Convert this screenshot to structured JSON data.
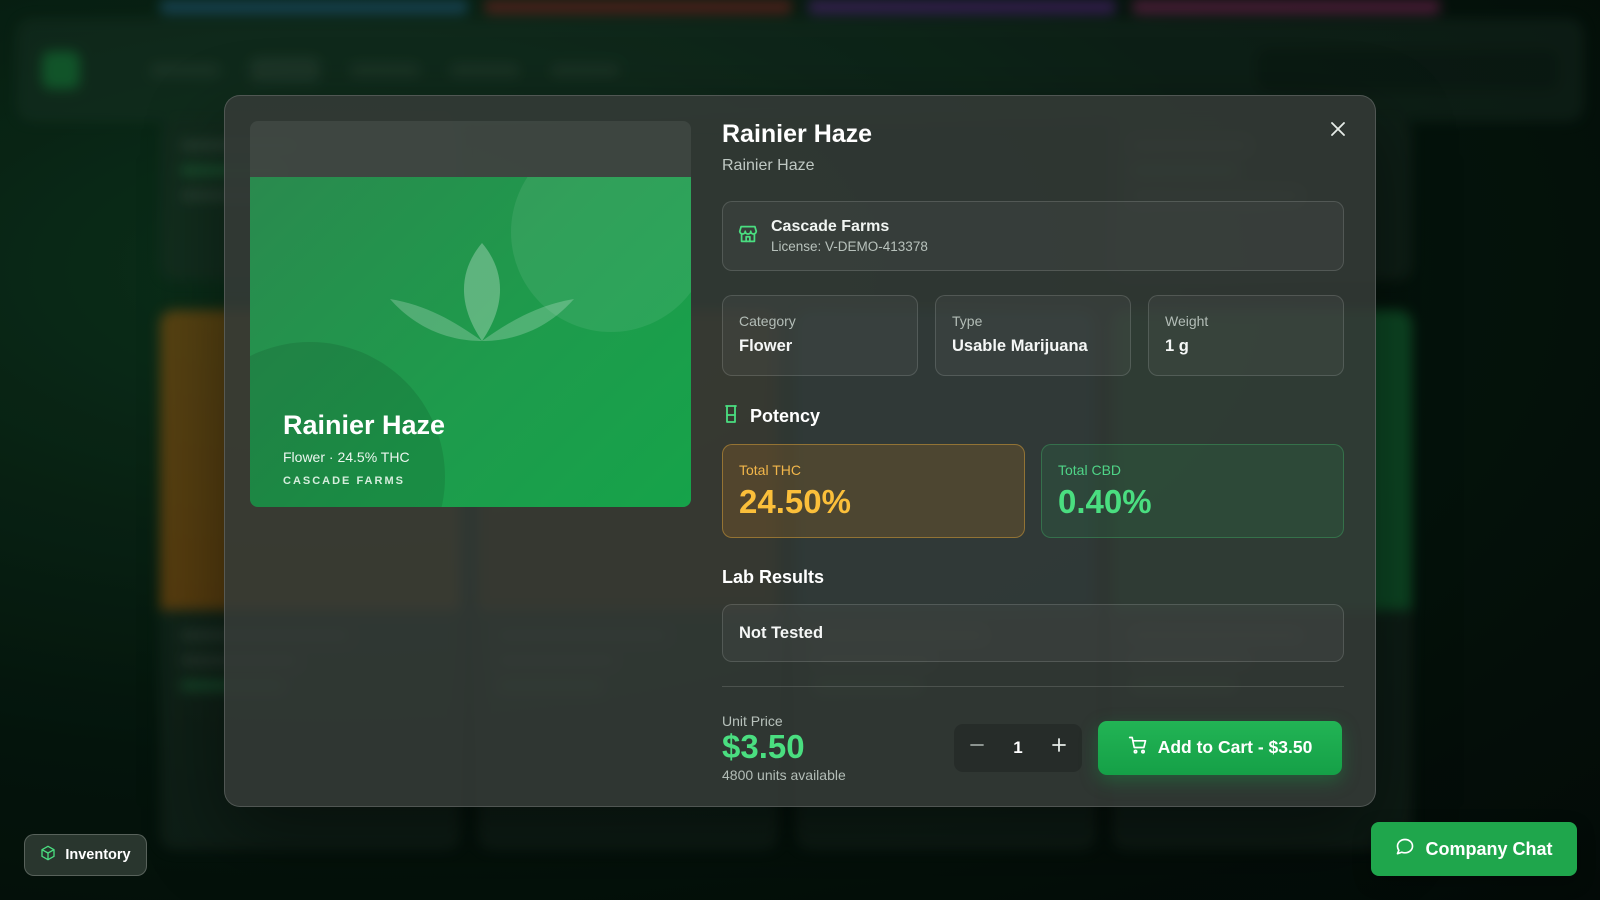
{
  "product": {
    "name": "Rainier Haze",
    "strain": "Rainier Haze",
    "hero_subtitle": "Flower · 24.5% THC",
    "hero_brand": "CASCADE FARMS"
  },
  "vendor": {
    "name": "Cascade Farms",
    "license": "License: V-DEMO-413378"
  },
  "specs": [
    {
      "label": "Category",
      "value": "Flower"
    },
    {
      "label": "Type",
      "value": "Usable Marijuana"
    },
    {
      "label": "Weight",
      "value": "1 g"
    }
  ],
  "potency": {
    "heading": "Potency",
    "thc_label": "Total THC",
    "thc_value": "24.50%",
    "cbd_label": "Total CBD",
    "cbd_value": "0.40%"
  },
  "lab": {
    "heading": "Lab Results",
    "status": "Not Tested"
  },
  "purchase": {
    "price_label": "Unit Price",
    "price": "$3.50",
    "stock": "4800 units available",
    "quantity": "1",
    "add_label": "Add to Cart - $3.50"
  },
  "floating": {
    "inventory_label": "Inventory",
    "chat_label": "Company Chat"
  },
  "colors": {
    "accent": "#16a34a",
    "thc": "#fbbf3a",
    "cbd": "#4ade80"
  },
  "icons": {
    "close": "close-icon",
    "vendor": "storefront-icon",
    "potency": "beaker-icon",
    "cart": "cart-icon",
    "inventory": "cube-icon",
    "chat": "chat-bubble-icon"
  }
}
